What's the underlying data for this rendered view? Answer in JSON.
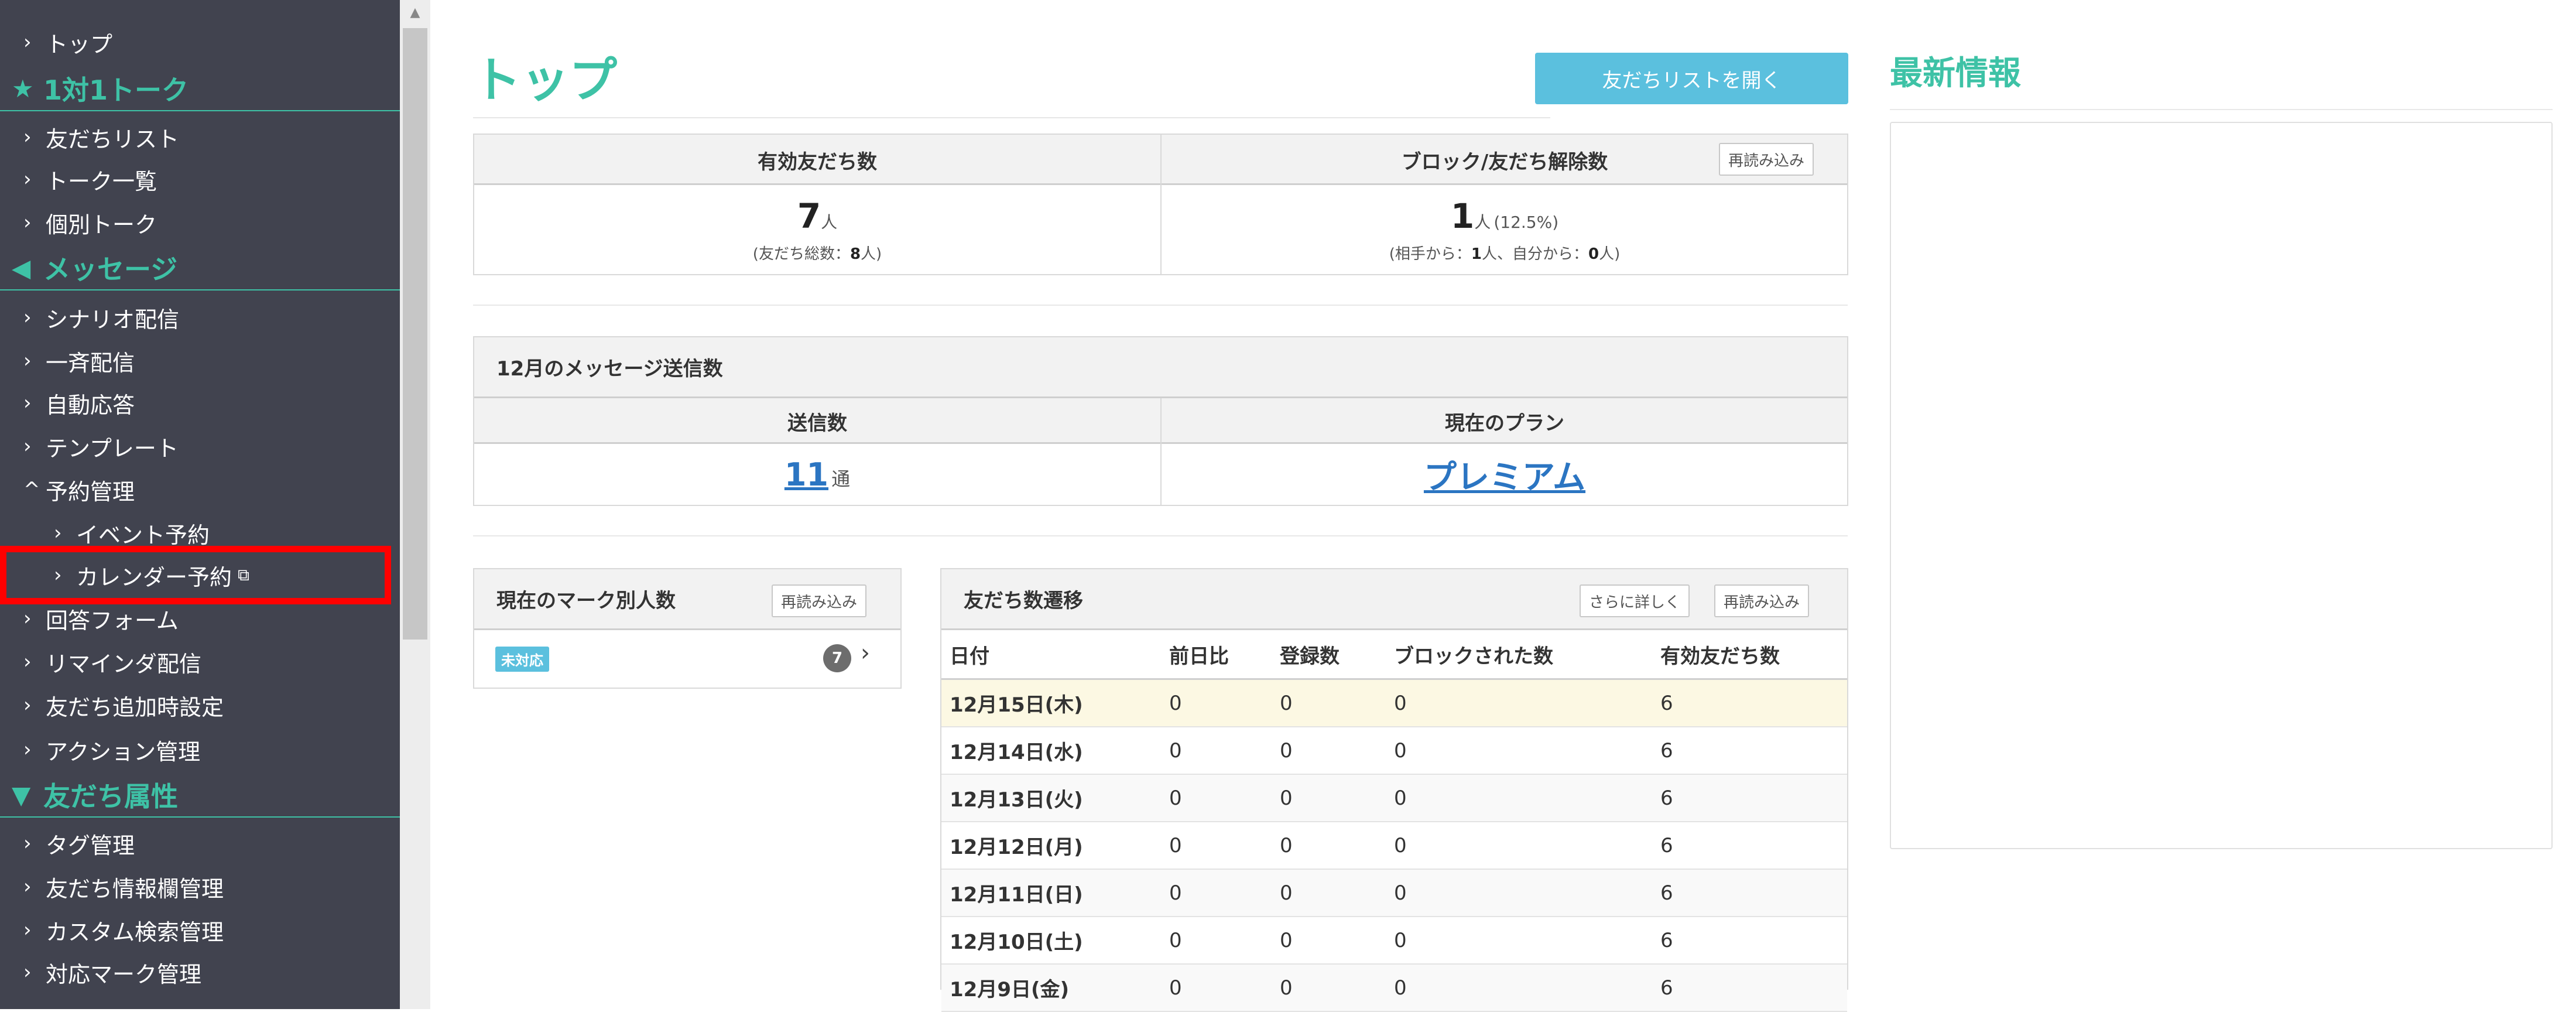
{
  "sidebar": {
    "items": [
      {
        "label": "トップ"
      },
      {
        "section": "1対1トーク",
        "icon": "star-icon"
      },
      {
        "label": "友だちリスト"
      },
      {
        "label": "トーク一覧"
      },
      {
        "label": "個別トーク"
      },
      {
        "section": "メッセージ",
        "icon": "megaphone-icon"
      },
      {
        "label": "シナリオ配信"
      },
      {
        "label": "一斉配信"
      },
      {
        "label": "自動応答"
      },
      {
        "label": "テンプレート"
      },
      {
        "label": "予約管理",
        "expanded": true
      },
      {
        "label": "イベント予約"
      },
      {
        "label": "カレンダー予約",
        "external": true,
        "highlighted": true
      },
      {
        "label": "回答フォーム"
      },
      {
        "label": "リマインダ配信"
      },
      {
        "label": "友だち追加時設定"
      },
      {
        "label": "アクション管理"
      },
      {
        "section": "友だち属性",
        "icon": "filter-icon"
      },
      {
        "label": "タグ管理"
      },
      {
        "label": "友だち情報欄管理"
      },
      {
        "label": "カスタム検索管理"
      },
      {
        "label": "対応マーク管理"
      }
    ],
    "highlight_color": "#ff0000",
    "section_color": "#3ec2a6"
  },
  "header": {
    "title": "トップ",
    "open_friend_list_label": "友だちリストを開く"
  },
  "friend_stats": {
    "valid_friends_label": "有効友だち数",
    "valid_friends_value": "7",
    "valid_friends_unit": "人",
    "total_note_prefix": "(友だち総数：",
    "total_count": "8",
    "total_note_suffix": "人)",
    "block_label": "ブロック/友だち解除数",
    "block_value": "1",
    "block_unit": "人",
    "block_percent": "(12.5%)",
    "block_note_prefix": "(相手から：",
    "block_from_other": "1",
    "block_note_mid": "人、自分から：",
    "block_from_self": "0",
    "block_note_suffix": "人)",
    "reload_label": "再読み込み"
  },
  "messages": {
    "title": "12月のメッセージ送信数",
    "sent_label": "送信数",
    "sent_value": "11",
    "sent_unit": "通",
    "plan_label": "現在のプラン",
    "plan_value": "プレミアム"
  },
  "marks": {
    "title": "現在のマーク別人数",
    "reload_label": "再読み込み",
    "badge": "未対応",
    "count": "7"
  },
  "trend": {
    "title": "友だち数遷移",
    "detail_label": "さらに詳しく",
    "reload_label": "再読み込み",
    "columns": [
      "日付",
      "前日比",
      "登録数",
      "ブロックされた数",
      "有効友だち数"
    ],
    "rows": [
      [
        "12月15日(木)",
        "0",
        "0",
        "0",
        "6"
      ],
      [
        "12月14日(水)",
        "0",
        "0",
        "0",
        "6"
      ],
      [
        "12月13日(火)",
        "0",
        "0",
        "0",
        "6"
      ],
      [
        "12月12日(月)",
        "0",
        "0",
        "0",
        "6"
      ],
      [
        "12月11日(日)",
        "0",
        "0",
        "0",
        "6"
      ],
      [
        "12月10日(土)",
        "0",
        "0",
        "0",
        "6"
      ],
      [
        "12月9日(金)",
        "0",
        "0",
        "0",
        "6"
      ]
    ]
  },
  "news": {
    "title": "最新情報"
  },
  "colors": {
    "accent": "#3ec2a6",
    "button": "#5bc0de",
    "link": "#2b75c2",
    "sidebar_bg": "#41434f"
  }
}
